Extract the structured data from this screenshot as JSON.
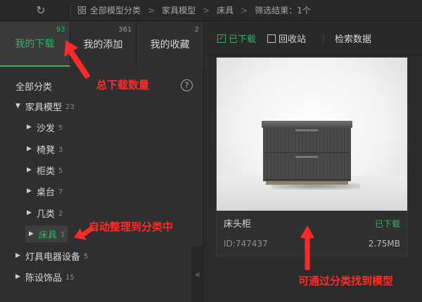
{
  "toolbar": {
    "breadcrumb": [
      "全部模型分类",
      "家具模型",
      "床具",
      "筛选结果：1个"
    ]
  },
  "tabs": [
    {
      "label": "我的下载",
      "count": "93"
    },
    {
      "label": "我的添加",
      "count": "361"
    },
    {
      "label": "我的收藏",
      "count": "2"
    }
  ],
  "sidebar": {
    "title": "全部分类",
    "help": "?",
    "tree": [
      {
        "label": "家具模型",
        "count": "23"
      },
      {
        "label": "沙发",
        "count": "5"
      },
      {
        "label": "椅凳",
        "count": "3"
      },
      {
        "label": "柜类",
        "count": "5"
      },
      {
        "label": "桌台",
        "count": "7"
      },
      {
        "label": "几类",
        "count": "2"
      },
      {
        "label": "床具",
        "count": "1"
      },
      {
        "label": "灯具电器设备",
        "count": "5"
      },
      {
        "label": "陈设饰品",
        "count": "15"
      }
    ]
  },
  "filters": {
    "downloaded": "已下载",
    "recycle": "回收站",
    "search": "检索数据"
  },
  "model": {
    "name": "床头柜",
    "status": "已下载",
    "id": "ID:747437",
    "size": "2.75MB"
  },
  "annotations": {
    "total_downloads": "总下载数量",
    "auto_sort": "自动整理到分类中",
    "find_by_category": "可通过分类找到模型"
  },
  "colors": {
    "accent": "#34b16a",
    "annotation": "#ff2a2a"
  }
}
